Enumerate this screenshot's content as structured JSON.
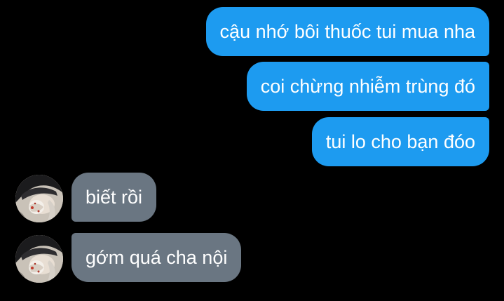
{
  "messages": [
    {
      "direction": "outgoing",
      "text": "cậu nhớ bôi thuốc tui mua nha"
    },
    {
      "direction": "outgoing",
      "text": "coi chừng nhiễm trùng đó"
    },
    {
      "direction": "outgoing",
      "text": "tui lo cho bạn đóo"
    },
    {
      "direction": "incoming",
      "text": "biết rồi"
    },
    {
      "direction": "incoming",
      "text": "gớm quá cha nội"
    }
  ],
  "colors": {
    "background": "#000000",
    "outgoing_bubble": "#1d9bf0",
    "incoming_bubble": "#6a7682",
    "text": "#ffffff"
  },
  "icons": {
    "avatar": "user-avatar-photo"
  }
}
